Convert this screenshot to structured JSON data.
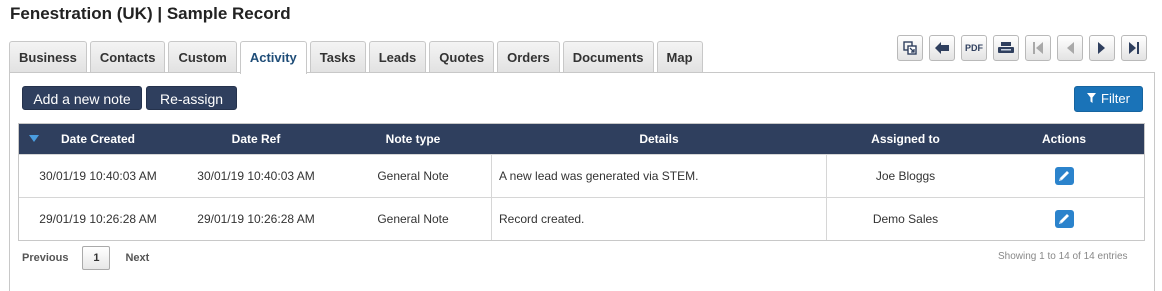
{
  "page": {
    "title": "Fenestration (UK) | Sample Record"
  },
  "tabs": [
    {
      "label": "Business",
      "active": false
    },
    {
      "label": "Contacts",
      "active": false
    },
    {
      "label": "Custom",
      "active": false
    },
    {
      "label": "Activity",
      "active": true
    },
    {
      "label": "Tasks",
      "active": false
    },
    {
      "label": "Leads",
      "active": false
    },
    {
      "label": "Quotes",
      "active": false
    },
    {
      "label": "Orders",
      "active": false
    },
    {
      "label": "Documents",
      "active": false
    },
    {
      "label": "Map",
      "active": false
    }
  ],
  "toolbar": {
    "pdf_label": "PDF",
    "icons": [
      "link-record-icon",
      "back-arrow-icon",
      "pdf-icon",
      "print-icon",
      "first-record-icon",
      "previous-record-icon",
      "next-record-icon",
      "last-record-icon"
    ]
  },
  "actions": {
    "add_note_label": "Add a new note",
    "reassign_label": "Re-assign",
    "filter_label": "Filter"
  },
  "table": {
    "columns": [
      "Date Created",
      "Date Ref",
      "Note type",
      "Details",
      "Assigned to",
      "Actions"
    ],
    "sort_direction": "descending",
    "rows": [
      {
        "date_created": "30/01/19 10:40:03 AM",
        "date_ref": "30/01/19 10:40:03 AM",
        "note_type": "General Note",
        "details": "A new lead was generated via STEM.",
        "assigned_to": "Joe Bloggs"
      },
      {
        "date_created": "29/01/19 10:26:28 AM",
        "date_ref": "29/01/19 10:26:28 AM",
        "note_type": "General Note",
        "details": "Record created.",
        "assigned_to": "Demo Sales"
      }
    ]
  },
  "pagination": {
    "previous_label": "Previous",
    "current_page": "1",
    "next_label": "Next",
    "info": "Showing 1 to 14 of 14 entries"
  },
  "colors": {
    "header_bg": "#2f3f5e",
    "filter_bg": "#1a73b8",
    "edit_icon_bg": "#2b83cc",
    "active_tab_text": "#1f4d78"
  }
}
